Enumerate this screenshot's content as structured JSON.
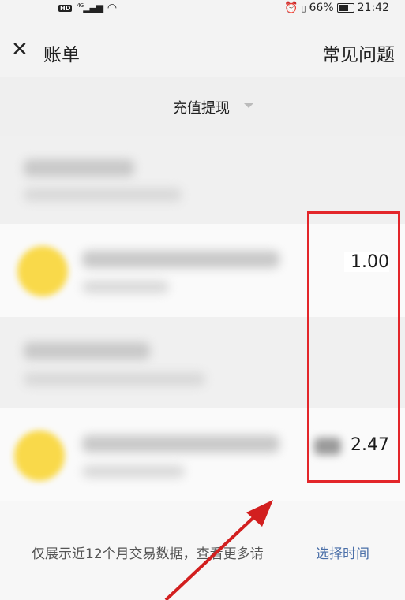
{
  "status_bar": {
    "hd_badge": "HD",
    "network": "4G",
    "right_text": "66%",
    "time": "21:42"
  },
  "header": {
    "close_icon": "close-icon",
    "title": "账单",
    "help_link": "常见问题"
  },
  "filter": {
    "label": "充值提现",
    "icon": "chevron-down-icon"
  },
  "transactions": [
    {
      "amount": "1.00"
    },
    {
      "amount": "2.47"
    }
  ],
  "footer": {
    "text": "仅展示近12个月交易数据，查看更多请",
    "link": "选择时间"
  },
  "colors": {
    "annotation_red": "#e3262a",
    "link_blue": "#4a6fa8",
    "avatar_yellow": "#f9d94a"
  }
}
